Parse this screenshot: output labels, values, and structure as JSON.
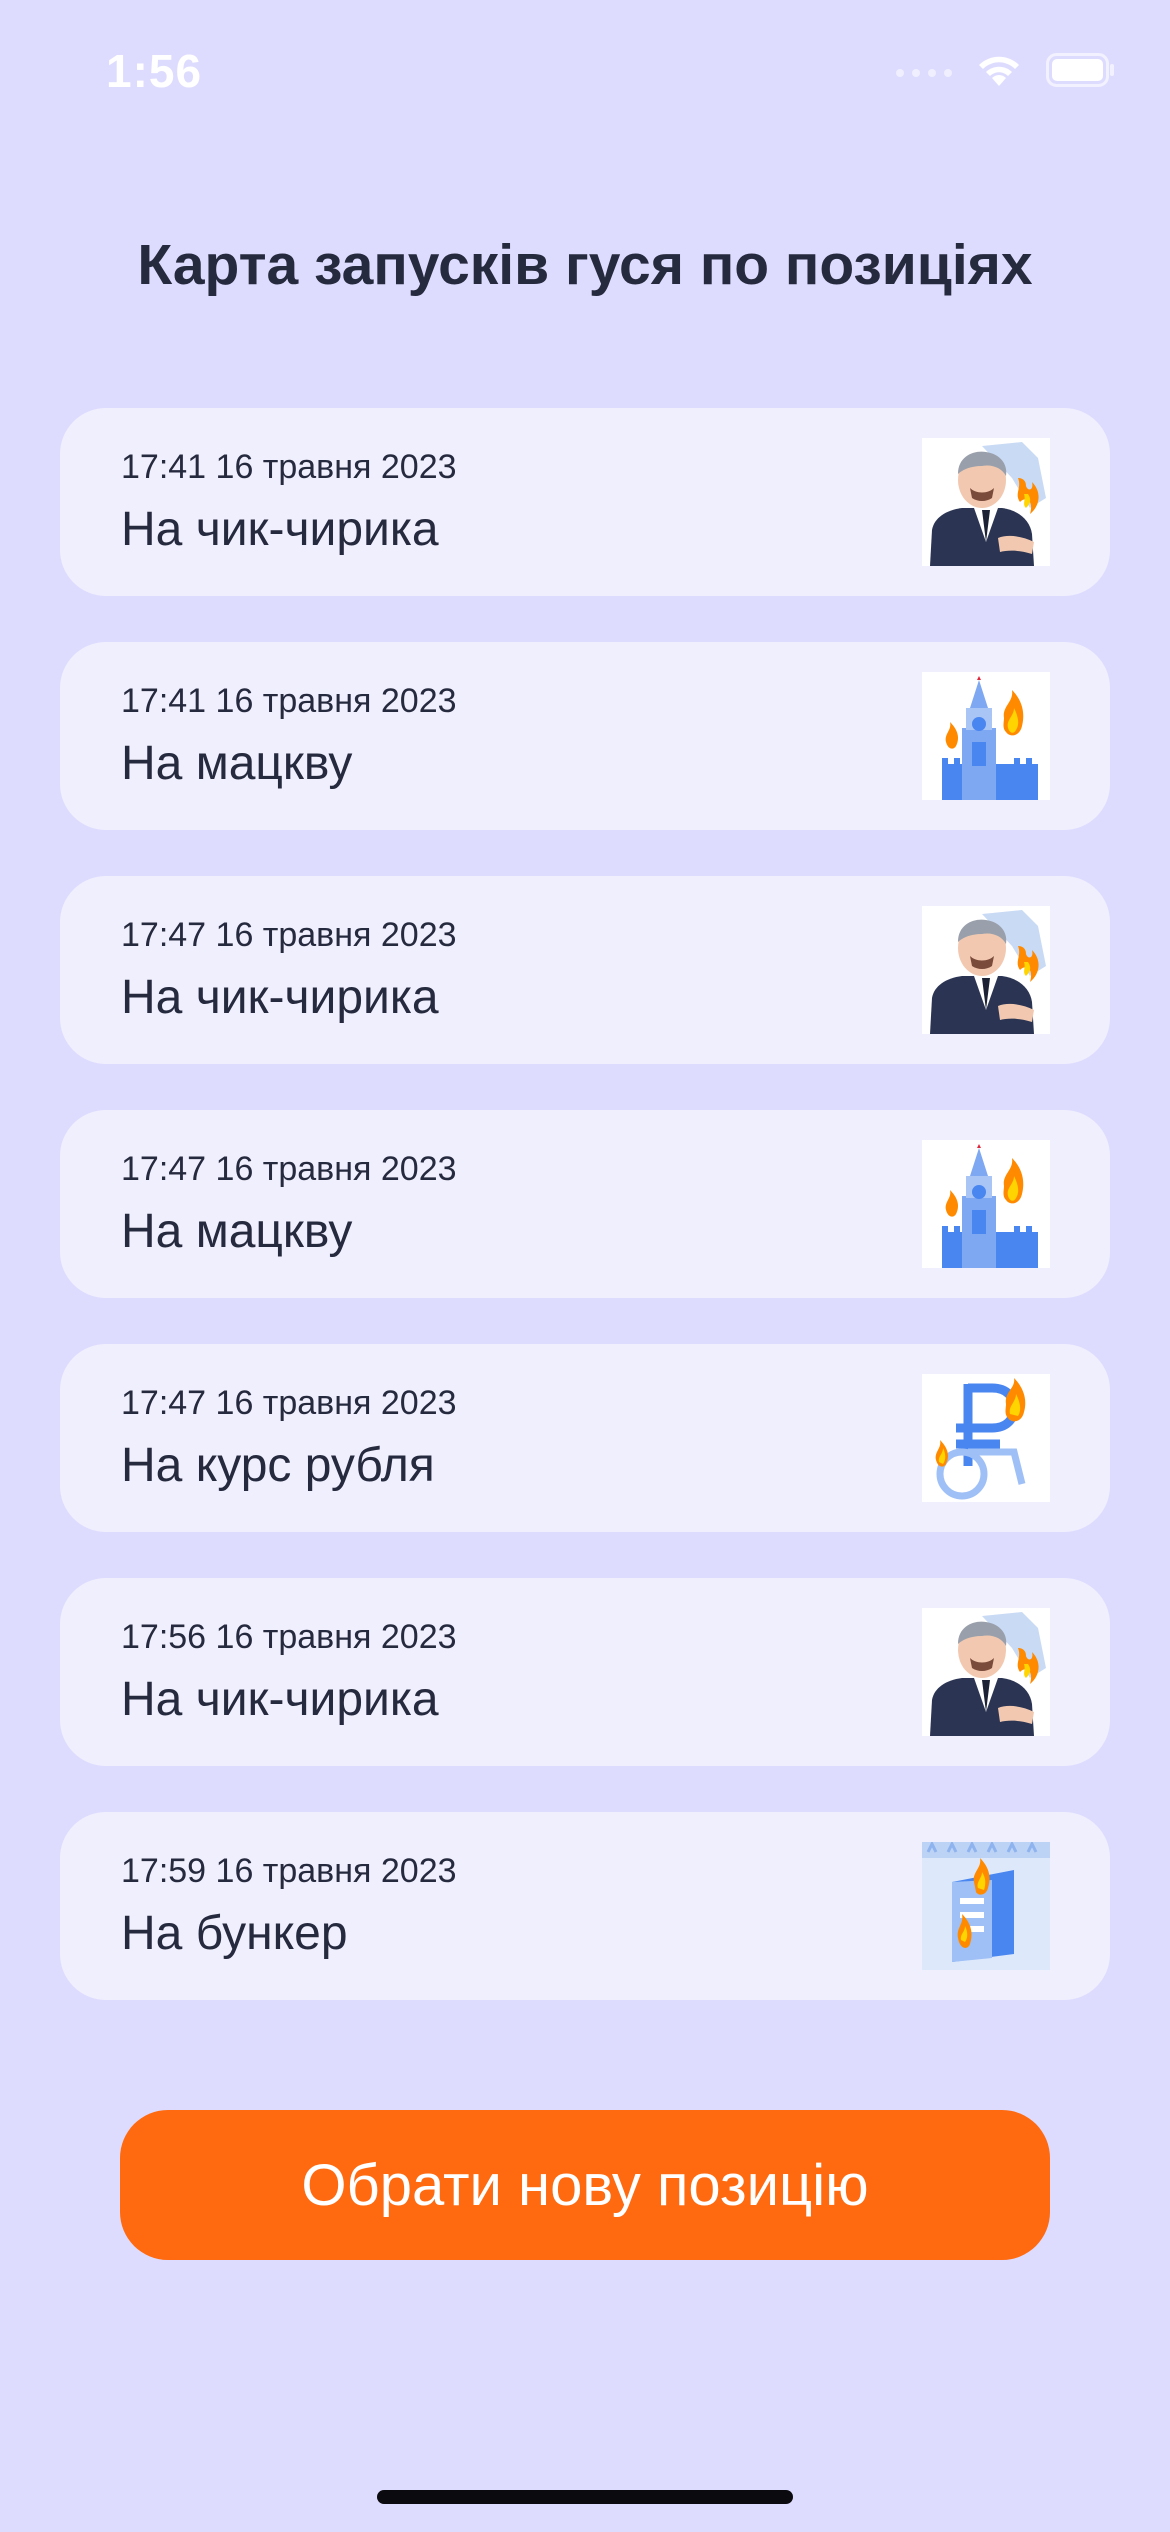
{
  "status_bar": {
    "time": "1:56",
    "icons": [
      "cellular-signal-icon",
      "wifi-icon",
      "battery-icon"
    ]
  },
  "page_title": "Карта запусків гуся по позиціях",
  "launches": [
    {
      "time": "17:41 16 травня 2023",
      "label": "На чик-чирика",
      "icon": "leader-on-fire-icon"
    },
    {
      "time": "17:41 16 травня 2023",
      "label": "На мацкву",
      "icon": "kremlin-tower-on-fire-icon"
    },
    {
      "time": "17:47 16 травня 2023",
      "label": "На чик-чирика",
      "icon": "leader-on-fire-icon"
    },
    {
      "time": "17:47 16 травня 2023",
      "label": "На мацкву",
      "icon": "kremlin-tower-on-fire-icon"
    },
    {
      "time": "17:47 16 травня 2023",
      "label": "На курс рубля",
      "icon": "ruble-wheelchair-on-fire-icon"
    },
    {
      "time": "17:56 16 травня 2023",
      "label": "На чик-чирика",
      "icon": "leader-on-fire-icon"
    },
    {
      "time": "17:59 16 травня 2023",
      "label": "На бункер",
      "icon": "bunker-on-fire-icon"
    }
  ],
  "primary_action": {
    "label": "Обрати нову позицію"
  },
  "colors": {
    "background": "#dedcfe",
    "card": "#f0effd",
    "text": "#262a3e",
    "accent": "#ff6a10"
  }
}
